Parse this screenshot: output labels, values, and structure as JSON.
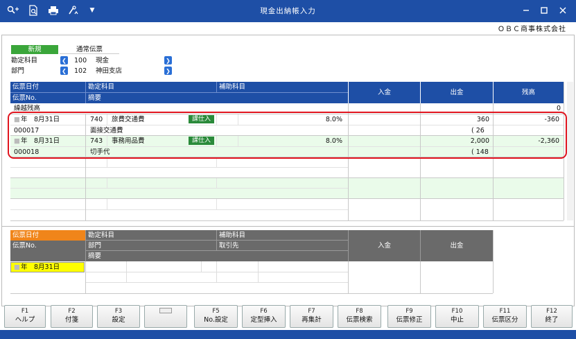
{
  "window": {
    "title": "現金出納帳入力",
    "company": "ＯＢＣ商事株式会社"
  },
  "header": {
    "mode": "新規",
    "voucher_type": "通常伝票",
    "account_label": "勘定科目",
    "account_code": "100",
    "account_name": "現金",
    "dept_label": "部門",
    "dept_code": "102",
    "dept_name": "神田支店"
  },
  "grid_headers": {
    "date": "伝票日付",
    "account": "勘定科目",
    "sub_account": "補助科目",
    "voucher_no": "伝票No.",
    "summary": "摘要",
    "deposit": "入金",
    "withdrawal": "出金",
    "balance": "残高"
  },
  "carryover": {
    "label": "繰越残高",
    "balance": "0"
  },
  "entries": [
    {
      "date_era": "年",
      "date": "8月31日",
      "code": "740",
      "account": "旅費交通費",
      "tax": "課仕入",
      "rate": "8.0%",
      "deposit": "",
      "withdrawal": "360",
      "balance": "-360",
      "voucher_no": "000017",
      "summary": "面接交通費",
      "tax_amount": "( 26"
    },
    {
      "date_era": "年",
      "date": "8月31日",
      "code": "743",
      "account": "事務用品費",
      "tax": "課仕入",
      "rate": "8.0%",
      "deposit": "",
      "withdrawal": "2,000",
      "balance": "-2,360",
      "voucher_no": "000018",
      "summary": "切手代",
      "tax_amount": "( 148"
    }
  ],
  "input_headers": {
    "date": "伝票日付",
    "account": "勘定科目",
    "sub_account": "補助科目",
    "voucher_no": "伝票No.",
    "dept": "部門",
    "partner": "取引先",
    "summary": "摘要",
    "deposit": "入金",
    "withdrawal": "出金"
  },
  "input_row": {
    "date_era": "年",
    "date": "8月31日"
  },
  "fkeys": [
    {
      "key": "F1",
      "label": "ヘルプ"
    },
    {
      "key": "F2",
      "label": "付箋"
    },
    {
      "key": "F3",
      "label": "設定"
    },
    {
      "key": "",
      "label": ""
    },
    {
      "key": "F5",
      "label": "No.設定"
    },
    {
      "key": "F6",
      "label": "定型挿入"
    },
    {
      "key": "F7",
      "label": "再集計"
    },
    {
      "key": "F8",
      "label": "伝票検索"
    },
    {
      "key": "F9",
      "label": "伝票修正"
    },
    {
      "key": "F10",
      "label": "中止"
    },
    {
      "key": "F11",
      "label": "伝票区分"
    },
    {
      "key": "F12",
      "label": "終了"
    }
  ],
  "colors": {
    "accent": "#1e4fa6",
    "highlight_ring": "#e0141e",
    "row_alt": "#eafbea",
    "date_input": "#ffff00"
  }
}
